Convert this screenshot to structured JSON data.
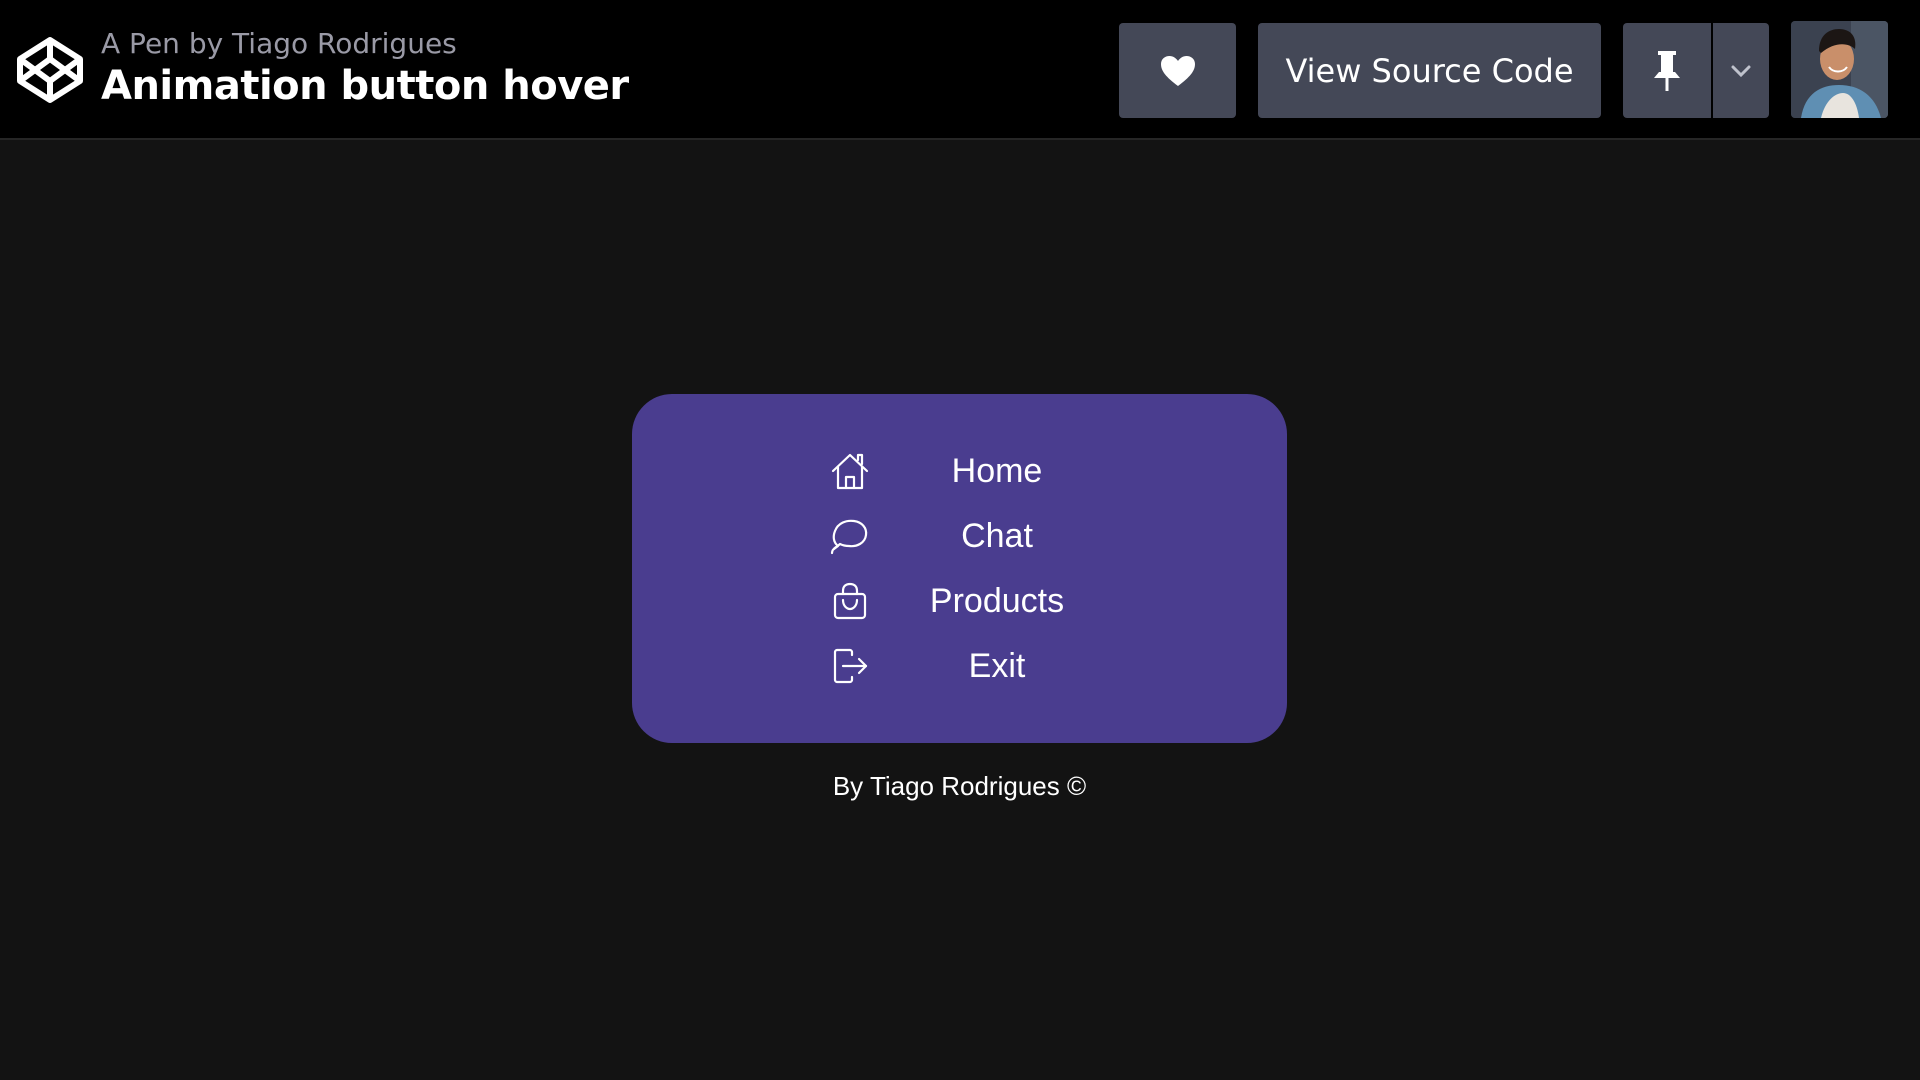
{
  "header": {
    "author_line": "A Pen by Tiago Rodrigues",
    "title": "Animation button hover",
    "logo_icon": "codepen-logo-icon",
    "buttons": {
      "heart_icon": "heart-icon",
      "view_source_label": "View Source Code",
      "pin_icon": "pin-icon",
      "dropdown_icon": "chevron-down-icon"
    },
    "avatar": "user-avatar"
  },
  "menu": {
    "background": "#4a3d8f",
    "items": [
      {
        "label": "Home",
        "icon": "home-icon"
      },
      {
        "label": "Chat",
        "icon": "chat-icon"
      },
      {
        "label": "Products",
        "icon": "shopping-bag-icon"
      },
      {
        "label": "Exit",
        "icon": "exit-icon"
      }
    ]
  },
  "footer": {
    "credit": "By Tiago Rodrigues ©"
  },
  "colors": {
    "page_bg": "#131313",
    "topbar_bg": "#000000",
    "button_bg": "#444857",
    "menu_bg": "#4a3d8f",
    "text": "#ffffff",
    "muted_text": "#9a9aa6"
  }
}
